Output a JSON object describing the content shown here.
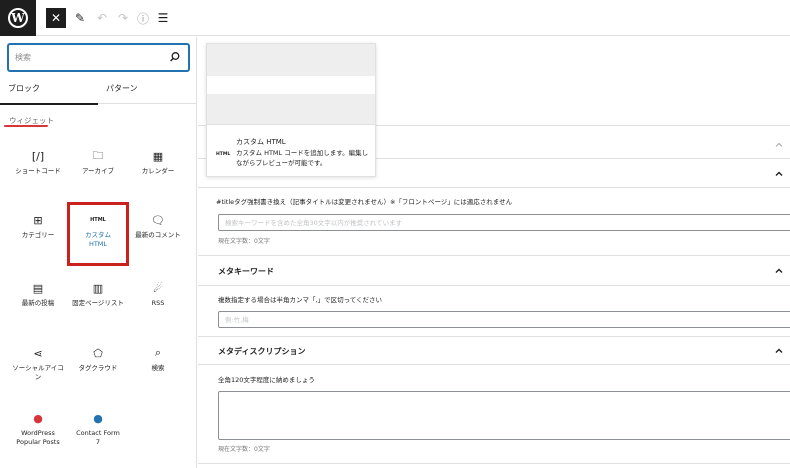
{
  "toolbar": {
    "logo_letter": "W",
    "close_glyph": "✕",
    "pen_glyph": "✎",
    "undo_glyph": "↶",
    "redo_glyph": "↷",
    "info_glyph": "ⓘ",
    "list_glyph": "☰"
  },
  "inserter": {
    "search": {
      "placeholder": "検索",
      "value": ""
    },
    "tabs": {
      "blocks": "ブロック",
      "patterns": "パターン"
    },
    "category": "ウィジェット",
    "blocks": [
      {
        "label": "ショートコード",
        "icon": "shortcode-icon",
        "glyph": "[/]"
      },
      {
        "label": "アーカイブ",
        "icon": "archive-icon",
        "glyph": "🗀"
      },
      {
        "label": "カレンダー",
        "icon": "calendar-icon",
        "glyph": "▦"
      },
      {
        "label": "カテゴリー",
        "icon": "categories-icon",
        "glyph": "⊞"
      },
      {
        "label": "カスタム HTML",
        "icon": "html-icon",
        "glyph": "HTML"
      },
      {
        "label": "最新のコメント",
        "icon": "comment-icon",
        "glyph": "🗨"
      },
      {
        "label": "最新の投稿",
        "icon": "latest-posts-icon",
        "glyph": "▤"
      },
      {
        "label": "固定ページリスト",
        "icon": "page-list-icon",
        "glyph": "▥"
      },
      {
        "label": "RSS",
        "icon": "rss-icon",
        "glyph": "☄"
      },
      {
        "label": "ソーシャルアイコン",
        "icon": "share-icon",
        "glyph": "⋖"
      },
      {
        "label": "タグクラウド",
        "icon": "tag-icon",
        "glyph": "⬠"
      },
      {
        "label": "検索",
        "icon": "search-icon",
        "glyph": "⌕"
      },
      {
        "label": "WordPress Popular Posts",
        "icon": "flame-icon",
        "glyph": "●"
      },
      {
        "label": "Contact Form 7",
        "icon": "contact-form-icon",
        "glyph": "●"
      }
    ]
  },
  "preview": {
    "icon_text": "HTML",
    "title": "カスタム HTML",
    "description": "カスタム HTML コードを追加します。編集しながらプレビューが可能です。"
  },
  "meta": {
    "title_field": {
      "label": "#titleタグ強制書き換え（記事タイトルは変更されません）※「フロントページ」には適応されません",
      "placeholder": "検索キーワードを含めた全角30文字以内が推奨されています",
      "counter": "現在文字数：0文字"
    },
    "keywords": {
      "heading": "メタキーワード",
      "help": "複数指定する場合は半角カンマ「,」で区切ってください",
      "placeholder": "例:竹,梅"
    },
    "description": {
      "heading": "メタディスクリプション",
      "help": "全角120文字程度に納めましょう",
      "counter": "現在文字数：0文字"
    }
  },
  "colors": {
    "accent": "#2271b1",
    "highlight": "#c9211e",
    "dark": "#1e1e1e"
  }
}
